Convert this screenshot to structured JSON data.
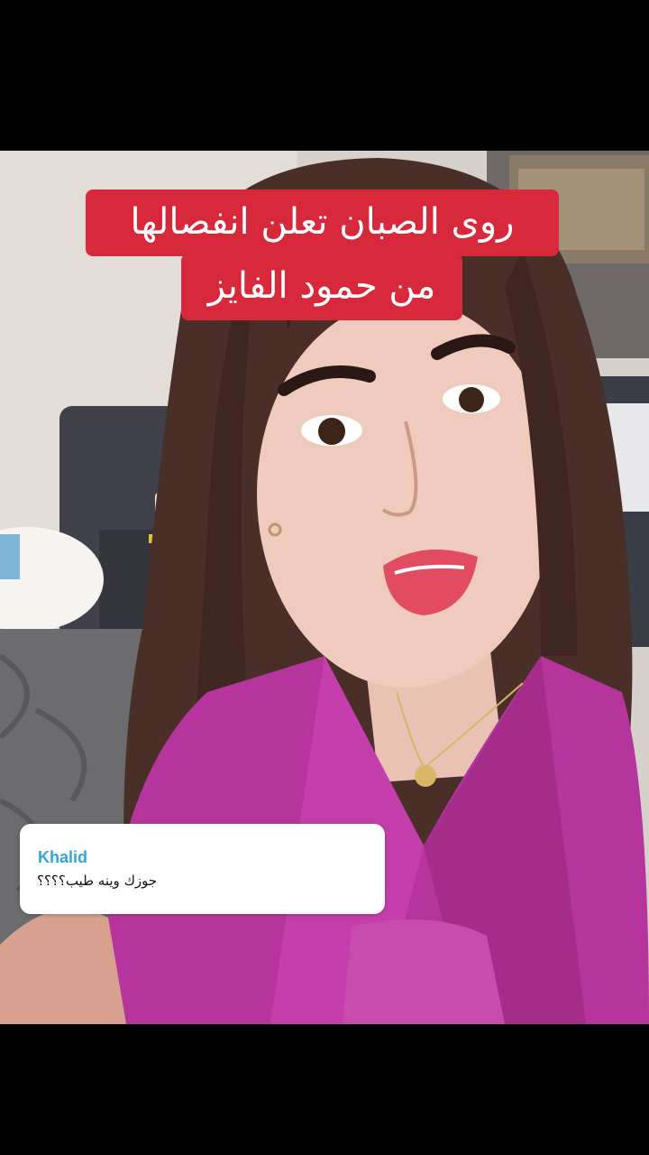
{
  "overlay": {
    "headline_line1": "روى الصبان تعلن انفصالها",
    "headline_line2": "من حمود الفايز"
  },
  "comment": {
    "author": "Khalid",
    "text": "جوزك وينه طيب؟؟؟؟"
  },
  "colors": {
    "headline_bg": "#d8283b",
    "author": "#2fa7dc",
    "letterbox": "#000000"
  }
}
